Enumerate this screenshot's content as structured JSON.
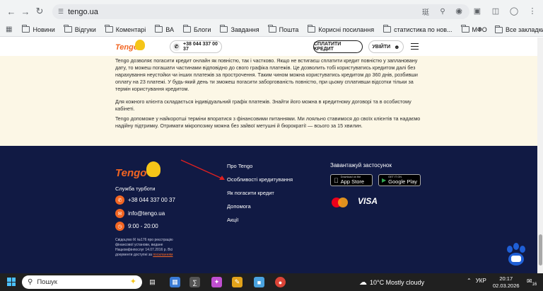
{
  "browser": {
    "url": "tengo.ua",
    "bookmarks": [
      "Новини",
      "Відгуки",
      "Коментарі",
      "ВА",
      "Блоги",
      "Завдання",
      "Пошта",
      "Корисні посилання",
      "статистика по нов...",
      "МФО"
    ],
    "more": "»",
    "all_bookmarks": "Все закладки"
  },
  "header": {
    "logo": "Tengo",
    "phone": "+38 044 337 00 37",
    "pay_button": "СПЛАТИТИ КРЕДИТ",
    "login_button": "УВІЙТИ"
  },
  "content": {
    "paragraphs": [
      "Tengo дозволяє погасити кредит онлайн як повністю, так і частково. Якщо не встигаєш сплатити кредит повністю у заплановану дату, то можеш погашати частинами відповідно до свого графіка платежів. Це дозволить тобі користуватись кредитом далі без нарахування неустойки чи інших платежів за прострочення. Таким чином можна користуватись кредитом до 360 днів, розбивши оплату на 23 платежі. У будь-який день ти зможеш погасити заборгованість повністю, при цьому сплативши відсотки тільки за термін користування кредитом.",
      "Для кожного клієнта складається індивідуальний графік платежів. Знайти його можна в кредитному договорі та в особистому кабінеті.",
      "Tengo допоможе у найкоротші терміни впоратися з фінансовими питаннями. Ми лояльно ставимося до своїх клієнтів та надаємо надійну підтримку. Отримати мікропозику можна без зайвої метушні й бюрократії — всього за 15 хвилин."
    ]
  },
  "footer": {
    "logo": "Tengo",
    "support_title": "Служба турботи",
    "phone": "+38 044 337 00 37",
    "email": "info@tengo.ua",
    "hours": "9:00 - 20:00",
    "legal_text": "Свідоцтво ІК №176 про реєстрацію фінансової установи, видане Нацкомфінпослуг 14.07.2016 р. Всі документи доступні за",
    "legal_link": "посиланням",
    "menu": [
      "Про Tengo",
      "Особливості кредитування",
      "Як погасити кредит",
      "Допомога",
      "Акції"
    ],
    "apps_title": "Завантажуй застосунок",
    "app_store_small": "Download on the",
    "app_store": "App Store",
    "google_play_small": "GET IT ON",
    "google_play": "Google Play",
    "visa": "VISA"
  },
  "taskbar": {
    "search_placeholder": "Пошук",
    "weather": "10°C  Mostly cloudy",
    "language": "УКР",
    "time": "20:17",
    "date": "02.03.2026",
    "notifications": "16"
  },
  "colors": {
    "brand_orange": "#f26522",
    "footer_bg": "#111a44",
    "content_bg": "#fcf7e6",
    "annotation_arrow": "#e02020"
  }
}
